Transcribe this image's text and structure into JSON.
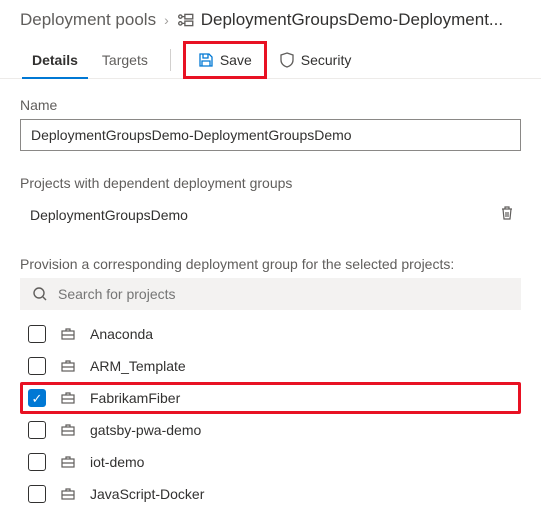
{
  "breadcrumb": {
    "root": "Deployment pools",
    "current": "DeploymentGroupsDemo-Deployment..."
  },
  "tabs": {
    "details": "Details",
    "targets": "Targets"
  },
  "actions": {
    "save": "Save",
    "security": "Security"
  },
  "name_section": {
    "label": "Name",
    "value": "DeploymentGroupsDemo-DeploymentGroupsDemo"
  },
  "dependent": {
    "label": "Projects with dependent deployment groups",
    "items": [
      "DeploymentGroupsDemo"
    ]
  },
  "provision": {
    "label": "Provision a corresponding deployment group for the selected projects:",
    "search_placeholder": "Search for projects",
    "projects": [
      {
        "name": "Anaconda",
        "checked": false
      },
      {
        "name": "ARM_Template",
        "checked": false
      },
      {
        "name": "FabrikamFiber",
        "checked": true
      },
      {
        "name": "gatsby-pwa-demo",
        "checked": false
      },
      {
        "name": "iot-demo",
        "checked": false
      },
      {
        "name": "JavaScript-Docker",
        "checked": false
      }
    ]
  }
}
